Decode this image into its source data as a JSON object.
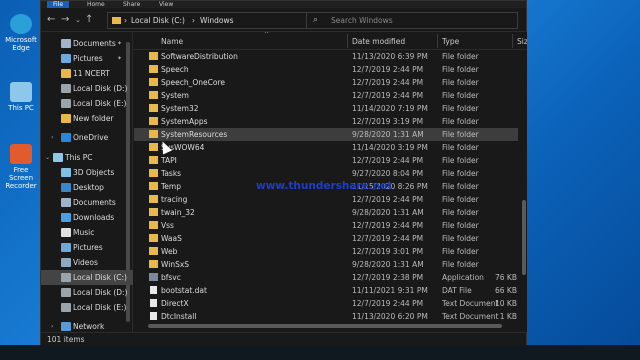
{
  "desktop": {
    "icons": [
      {
        "label": "Microsoft Edge",
        "icon": "edge-icon",
        "color": "#2aa0d8"
      },
      {
        "label": "This PC",
        "icon": "this-pc-icon",
        "color": "#8ec7ea"
      },
      {
        "label": "Free Screen Recorder",
        "icon": "screen-recorder-icon",
        "color": "#e25b2c"
      }
    ]
  },
  "ribbon": {
    "file": "File",
    "home": "Home",
    "share": "Share",
    "view": "View"
  },
  "address": {
    "root": "Local Disk (C:)",
    "folder": "Windows",
    "sep": "›"
  },
  "search": {
    "placeholder": "Search Windows"
  },
  "nav": {
    "items": [
      {
        "label": "Documents",
        "icon": "documents-icon",
        "pinned": true
      },
      {
        "label": "Pictures",
        "icon": "pictures-icon",
        "pinned": true
      },
      {
        "label": "11 NCERT",
        "icon": "folder-icon",
        "pinned": false
      },
      {
        "label": "Local Disk (D:)",
        "icon": "drive-icon",
        "pinned": false
      },
      {
        "label": "Local Disk (E:)",
        "icon": "drive-icon",
        "pinned": false
      },
      {
        "label": "New folder",
        "icon": "folder-icon",
        "pinned": false
      },
      {
        "label": "OneDrive",
        "icon": "onedrive-icon",
        "pinned": false
      },
      {
        "label": "This PC",
        "icon": "this-pc-icon",
        "pinned": false
      },
      {
        "label": "3D Objects",
        "icon": "3d-objects-icon",
        "pinned": false
      },
      {
        "label": "Desktop",
        "icon": "desktop-icon",
        "pinned": false
      },
      {
        "label": "Documents",
        "icon": "documents-icon",
        "pinned": false
      },
      {
        "label": "Downloads",
        "icon": "downloads-icon",
        "pinned": false
      },
      {
        "label": "Music",
        "icon": "music-icon",
        "pinned": false
      },
      {
        "label": "Pictures",
        "icon": "pictures-icon",
        "pinned": false
      },
      {
        "label": "Videos",
        "icon": "videos-icon",
        "pinned": false
      },
      {
        "label": "Local Disk (C:)",
        "icon": "drive-icon",
        "pinned": false
      },
      {
        "label": "Local Disk (D:)",
        "icon": "drive-icon",
        "pinned": false
      },
      {
        "label": "Local Disk (E:)",
        "icon": "drive-icon",
        "pinned": false
      },
      {
        "label": "Network",
        "icon": "network-icon",
        "pinned": false
      }
    ]
  },
  "columns": {
    "name": "Name",
    "date": "Date modified",
    "type": "Type",
    "size": "Size"
  },
  "files": [
    {
      "name": "SoftwareDistribution",
      "date": "11/13/2020 6:39 PM",
      "type": "File folder",
      "size": "",
      "kind": "folder"
    },
    {
      "name": "Speech",
      "date": "12/7/2019 2:44 PM",
      "type": "File folder",
      "size": "",
      "kind": "folder"
    },
    {
      "name": "Speech_OneCore",
      "date": "12/7/2019 2:44 PM",
      "type": "File folder",
      "size": "",
      "kind": "folder"
    },
    {
      "name": "System",
      "date": "12/7/2019 2:44 PM",
      "type": "File folder",
      "size": "",
      "kind": "folder"
    },
    {
      "name": "System32",
      "date": "11/14/2020 7:19 PM",
      "type": "File folder",
      "size": "",
      "kind": "folder"
    },
    {
      "name": "SystemApps",
      "date": "12/7/2019 3:19 PM",
      "type": "File folder",
      "size": "",
      "kind": "folder"
    },
    {
      "name": "SystemResources",
      "date": "9/28/2020 1:31 AM",
      "type": "File folder",
      "size": "",
      "kind": "folder"
    },
    {
      "name": "SysWOW64",
      "date": "11/14/2020 3:19 PM",
      "type": "File folder",
      "size": "",
      "kind": "folder"
    },
    {
      "name": "TAPI",
      "date": "12/7/2019 2:44 PM",
      "type": "File folder",
      "size": "",
      "kind": "folder"
    },
    {
      "name": "Tasks",
      "date": "9/27/2020 8:04 PM",
      "type": "File folder",
      "size": "",
      "kind": "folder"
    },
    {
      "name": "Temp",
      "date": "11/15/2020 8:26 PM",
      "type": "File folder",
      "size": "",
      "kind": "folder"
    },
    {
      "name": "tracing",
      "date": "12/7/2019 2:44 PM",
      "type": "File folder",
      "size": "",
      "kind": "folder"
    },
    {
      "name": "twain_32",
      "date": "9/28/2020 1:31 AM",
      "type": "File folder",
      "size": "",
      "kind": "folder"
    },
    {
      "name": "Vss",
      "date": "12/7/2019 2:44 PM",
      "type": "File folder",
      "size": "",
      "kind": "folder"
    },
    {
      "name": "WaaS",
      "date": "12/7/2019 2:44 PM",
      "type": "File folder",
      "size": "",
      "kind": "folder"
    },
    {
      "name": "Web",
      "date": "12/7/2019 3:01 PM",
      "type": "File folder",
      "size": "",
      "kind": "folder"
    },
    {
      "name": "WinSxS",
      "date": "9/28/2020 1:31 AM",
      "type": "File folder",
      "size": "",
      "kind": "folder"
    },
    {
      "name": "bfsvc",
      "date": "12/7/2019 2:38 PM",
      "type": "Application",
      "size": "76 KB",
      "kind": "app"
    },
    {
      "name": "bootstat.dat",
      "date": "11/11/2021 9:31 PM",
      "type": "DAT File",
      "size": "66 KB",
      "kind": "file"
    },
    {
      "name": "DirectX",
      "date": "12/7/2019 2:44 PM",
      "type": "Text Document",
      "size": "10 KB",
      "kind": "file"
    },
    {
      "name": "DtcInstall",
      "date": "11/13/2020 6:20 PM",
      "type": "Text Document",
      "size": "1 KB",
      "kind": "file"
    }
  ],
  "selected_row": 6,
  "selected_nav": 15,
  "status": {
    "items": "101 items"
  },
  "watermark": "www.thundershare.net",
  "colors": {
    "folder": "#e8b84a",
    "selection": "#3d3d3d",
    "watermark": "#1d3ec8"
  }
}
